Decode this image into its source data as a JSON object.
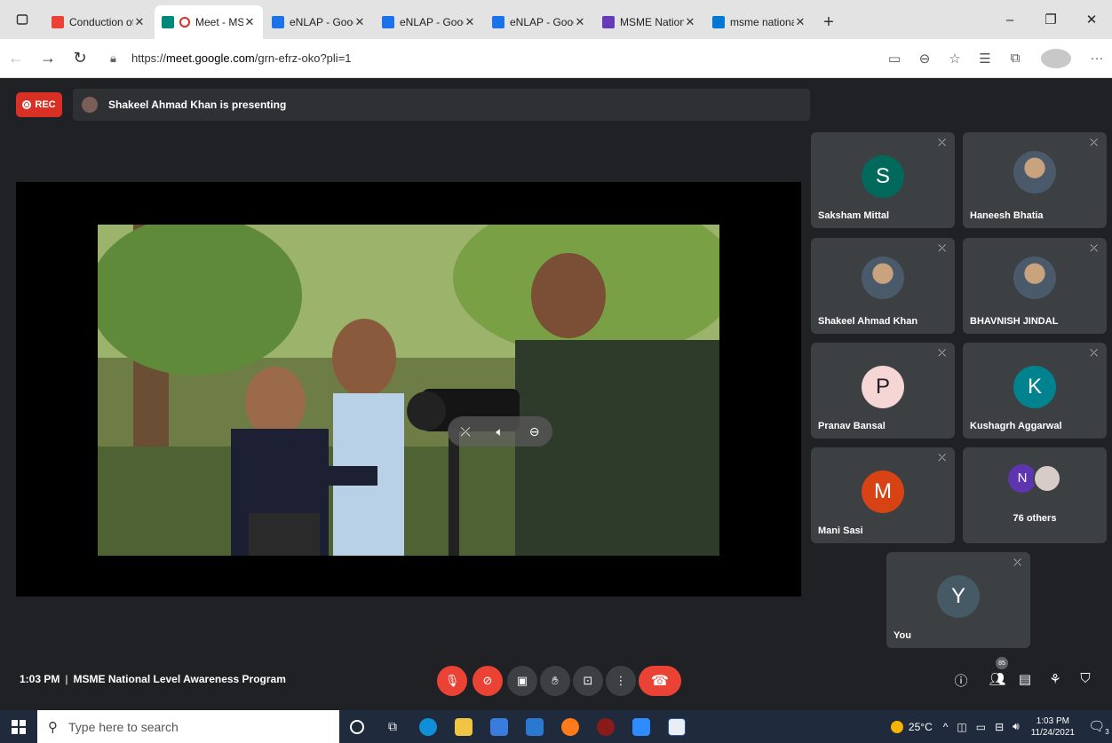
{
  "browser": {
    "tabs": [
      {
        "label": "Conduction of M",
        "icon": "gmail-icon",
        "color": "#ea4335",
        "active": false
      },
      {
        "label": "Meet - MSM",
        "icon": "meet-icon",
        "color": "#00897b",
        "active": true
      },
      {
        "label": "eNLAP - Google",
        "icon": "drive-icon",
        "color": "#1a73e8",
        "active": false
      },
      {
        "label": "eNLAP - Google",
        "icon": "drive-icon",
        "color": "#1a73e8",
        "active": false
      },
      {
        "label": "eNLAP - Google",
        "icon": "drive-icon",
        "color": "#1a73e8",
        "active": false
      },
      {
        "label": "MSME National L",
        "icon": "forms-icon",
        "color": "#673ab7",
        "active": false
      },
      {
        "label": "msme national le",
        "icon": "bing-icon",
        "color": "#0078d4",
        "active": false
      }
    ],
    "url_prefix": "https://",
    "url_host": "meet.google.com",
    "url_path": "/grn-efrz-oko?pli=1"
  },
  "meet": {
    "rec_label": "REC",
    "presenting_text": "Shakeel Ahmad Khan is presenting",
    "participants": [
      {
        "name": "Saksham Mittal",
        "letter": "S",
        "color": "#00695c"
      },
      {
        "name": "Haneesh Bhatia",
        "photo": true
      },
      {
        "name": "Shakeel Ahmad Khan",
        "photo": true
      },
      {
        "name": "BHAVNISH JINDAL",
        "photo": true
      },
      {
        "name": "Pranav Bansal",
        "letter": "P",
        "color": "#f6d5d5",
        "text_color": "#202124"
      },
      {
        "name": "Kushagrh Aggarwal",
        "letter": "K",
        "color": "#00838f"
      },
      {
        "name": "Mani Sasi",
        "letter": "M",
        "color": "#d84315"
      },
      {
        "name": "76 others",
        "others_letter": "N"
      },
      {
        "name": "You",
        "letter": "Y",
        "color": "#455a64"
      }
    ],
    "time": "1:03 PM",
    "meeting_title": "MSME National Level Awareness Program",
    "participant_count": "85"
  },
  "taskbar": {
    "search_placeholder": "Type here to search",
    "temperature": "25°C",
    "time": "1:03 PM",
    "date": "11/24/2021",
    "notif_count": "3"
  }
}
